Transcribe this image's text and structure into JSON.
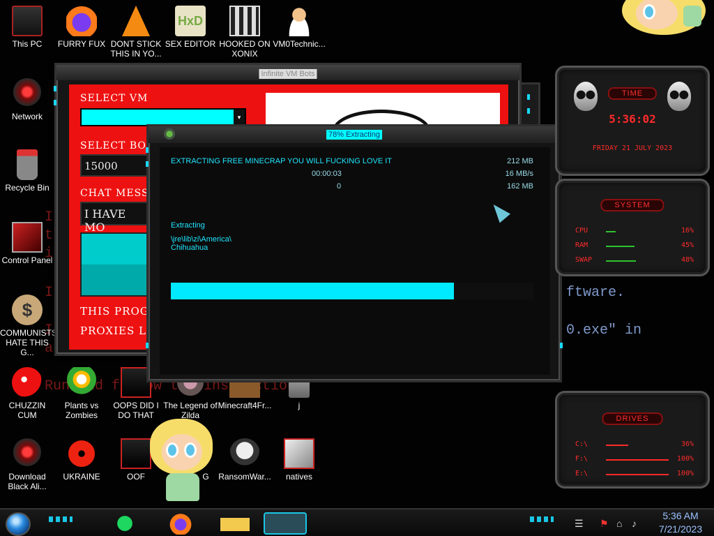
{
  "background_text": {
    "lines_red": [
      "I",
      "th",
      "i",
      "I",
      "I",
      "a",
      "Run and follow the instructions!"
    ],
    "lines_blue": [
      "ftware.",
      "0.exe\" in"
    ]
  },
  "desktop": {
    "icons": [
      {
        "label": "This PC",
        "icon": "computer-icon"
      },
      {
        "label": "FURRY FUX",
        "icon": "firefox-icon"
      },
      {
        "label": "DONT STICK THIS IN YO...",
        "icon": "vlc-cone-icon"
      },
      {
        "label": "SEX EDITOR",
        "icon": "hxd-icon"
      },
      {
        "label": "HOOKED ON XONIX",
        "icon": "maze-icon"
      },
      {
        "label": "VM0Technic...",
        "icon": "doctor-icon"
      },
      {
        "label": "Network",
        "icon": "alien-icon"
      },
      {
        "label": "Recycle Bin",
        "icon": "recycle-bin-icon"
      },
      {
        "label": "Control Panel",
        "icon": "control-panel-icon"
      },
      {
        "label": "COMMUNISTS HATE THIS G...",
        "icon": "money-bag-icon"
      },
      {
        "label": "CHUZZIN CUM",
        "icon": "fuzzball-icon"
      },
      {
        "label": "Plants vs Zombies",
        "icon": "plant-icon"
      },
      {
        "label": "OOPS DID I DO THAT",
        "icon": "oops-icon"
      },
      {
        "label": "The Legend of Zilda",
        "icon": "zelda-icon"
      },
      {
        "label": "Minecraft4Fr...",
        "icon": "minecraft-icon"
      },
      {
        "label": "j",
        "icon": "shortcut-icon"
      },
      {
        "label": "Download Black Ali...",
        "icon": "alien-icon"
      },
      {
        "label": "UKRAINE",
        "icon": "radiation-icon"
      },
      {
        "label": "OOF",
        "icon": "oops-icon"
      },
      {
        "label": "G",
        "icon": "app-icon"
      },
      {
        "label": "RansomWar...",
        "icon": "skull-icon"
      },
      {
        "label": "natives",
        "icon": "native-icon"
      }
    ]
  },
  "bot_window": {
    "title": "Infinite VM Bots",
    "select_vm_label": "SELECT VM",
    "select_bot_label": "SELECT BOT A",
    "bot_amount_value": "15000",
    "chat_message_label": "CHAT MESSAGE",
    "chat_message_value": "I HAVE MO",
    "footer_line1": "THIS PROGR",
    "footer_line2": "PROXIES L"
  },
  "extract_window": {
    "title": "78% Extracting",
    "progress_fraction": 0.78,
    "heading": "EXTRACTING FREE MINECRAP YOU WILL FUCKING LOVE IT",
    "elapsed": "00:00:03",
    "remaining": "0",
    "total_size": "212 MB",
    "speed": "16 MB/s",
    "processed": "162 MB",
    "status": "Extracting",
    "path_line1": "\\jre\\lib\\zi\\America\\",
    "path_line2": "Chihuahua"
  },
  "gadgets": {
    "time": {
      "title": "TIME",
      "time": "5:36:02",
      "date": "FRIDAY 21 JULY 2023"
    },
    "system": {
      "title": "SYSTEM",
      "rows": [
        {
          "label": "CPU",
          "value": "16%",
          "level": 0.16
        },
        {
          "label": "RAM",
          "value": "45%",
          "level": 0.45
        },
        {
          "label": "SWAP",
          "value": "48%",
          "level": 0.48
        }
      ]
    },
    "drives": {
      "title": "DRIVES",
      "rows": [
        {
          "label": "C:\\",
          "value": "36%",
          "level": 0.36
        },
        {
          "label": "F:\\",
          "value": "100%",
          "level": 1.0
        },
        {
          "label": "E:\\",
          "value": "100%",
          "level": 1.0
        }
      ]
    }
  },
  "taskbar": {
    "apps": [
      "spotify-icon",
      "firefox-icon",
      "file-explorer-icon",
      "minecraft-icon"
    ],
    "clock_time": "5:36 AM",
    "clock_date": "7/21/2023"
  },
  "colors": {
    "accent_cyan": "#00eaff",
    "alert_red": "#ee1111",
    "gadget_red": "#ff2a2a"
  }
}
